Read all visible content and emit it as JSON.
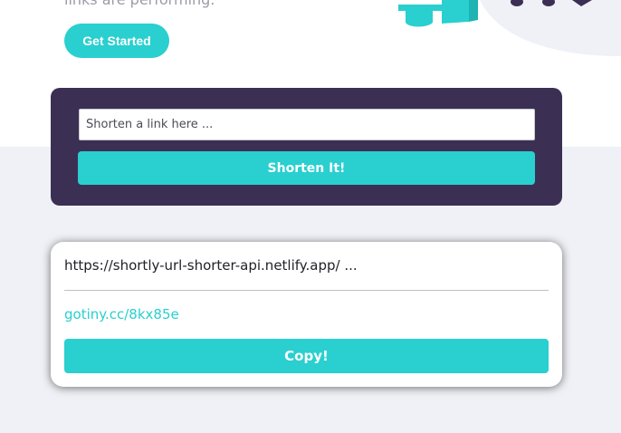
{
  "hero": {
    "text": "links are performing.",
    "cta_label": "Get Started"
  },
  "shortener": {
    "placeholder": "Shorten a link here ...",
    "button_label": "Shorten It!"
  },
  "result": {
    "original_url": "https://shortly-url-shorter-api.netlify.app/ ...",
    "short_url": "gotiny.cc/8kx85e",
    "copy_label": "Copy!"
  },
  "colors": {
    "accent": "#2acfcf",
    "dark_violet": "#3b3054",
    "gray_bg": "#f0f1f6",
    "text_gray": "#9e9aa7"
  },
  "icons": {
    "hero_illustration": "person-working-illustration"
  }
}
